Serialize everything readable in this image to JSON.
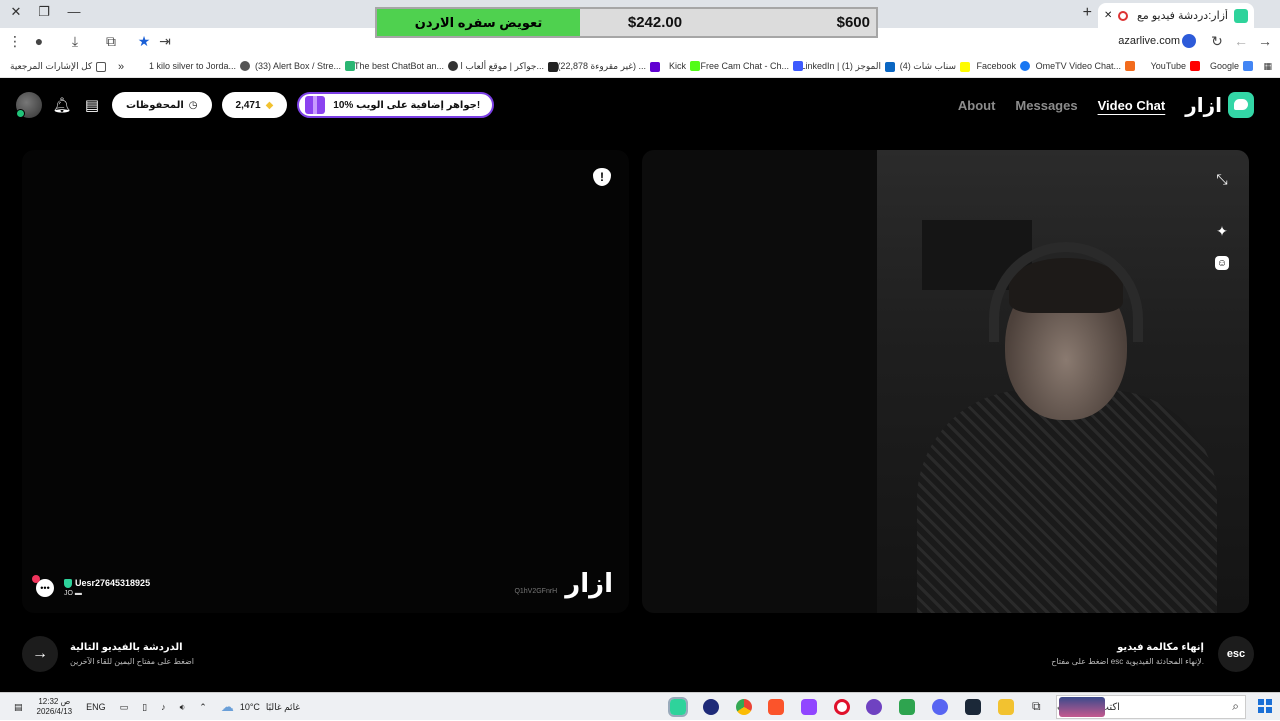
{
  "browser": {
    "tab_title": "أزار:دردشة فيديو مع أشخاص",
    "new_tab": "+",
    "url": "azarlive.com",
    "window_controls": {
      "minimize": "—",
      "restore": "❐",
      "close": "✕"
    },
    "bookmarks": [
      {
        "label": "Google",
        "color": "#4285f4"
      },
      {
        "label": "YouTube",
        "color": "#ff0000"
      },
      {
        "label": "OmeTV Video Chat...",
        "color": "#f26b1d"
      },
      {
        "label": "Facebook",
        "color": "#1877f2"
      },
      {
        "label": "(4) سناب شات",
        "color": "#fffc00"
      },
      {
        "label": "LinkedIn | (1) الموجز",
        "color": "#0a66c2"
      },
      {
        "label": "Free Cam Chat - Ch...",
        "color": "#3d5afe"
      },
      {
        "label": "Kick",
        "color": "#53fc18"
      },
      {
        "label": "(22,878 غير مقروءة) ...",
        "color": "#6001d2"
      },
      {
        "label": "جواكر | موقع ألعاب ا...",
        "color": "#222222"
      },
      {
        "label": "The best ChatBot an...",
        "color": "#333333"
      },
      {
        "label": "(33) Alert Box / Stre...",
        "color": "#2bb673"
      },
      {
        "label": "1 kilo silver to Jorda...",
        "color": "#555555"
      }
    ],
    "bookmarks_more": "»",
    "all_bookmarks": "كل الإشارات المرجعية"
  },
  "price_banner": {
    "label": "تعويض سفره الاردن",
    "current": "$242.00",
    "target": "$600"
  },
  "nav": {
    "brand": "ازار",
    "links": [
      {
        "label": "About",
        "active": false
      },
      {
        "label": "Messages",
        "active": false
      },
      {
        "label": "Video Chat",
        "active": true
      }
    ],
    "gems_count": "2,471",
    "saved_label": "المحفوظات",
    "promo_label": "10% جواهر إضافية على الويب!"
  },
  "left_panel": {
    "watermark": "ازار",
    "session_code": "Q1hV2GFnrH",
    "peer_name": "Uesr27645318925",
    "peer_country": "JO"
  },
  "next_action": {
    "title": "الدردشة بالفيديو التالية",
    "subtitle": "اضغط على مفتاح اليمين للقاء الآخرين"
  },
  "end_action": {
    "key": "esc",
    "title": "إنهاء مكالمة فيديو",
    "subtitle": "اضغط على مفتاح esc لإنهاء المحادثة الفيديوية."
  },
  "taskbar": {
    "search_placeholder": "اكتب هنا للبحث",
    "weather_text": "غائم غالبًا",
    "temperature": "10°C",
    "language": "ENG",
    "time": "12:32 ص",
    "date": "2026/4/13"
  }
}
